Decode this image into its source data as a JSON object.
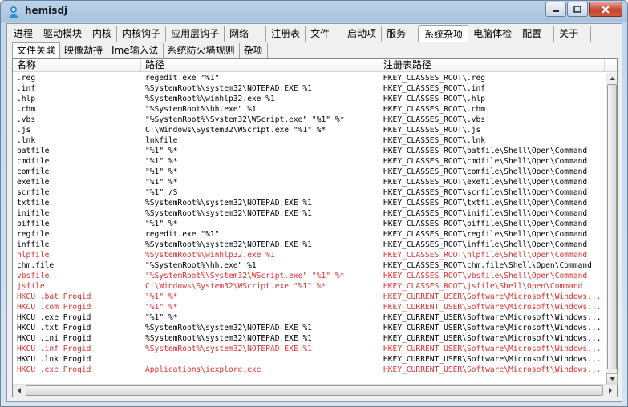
{
  "window": {
    "title": "hemisdj"
  },
  "caption": {
    "minimize": "▭",
    "maximize": "□",
    "close": "x"
  },
  "main_tabs": [
    {
      "label": "进程"
    },
    {
      "label": "驱动模块"
    },
    {
      "label": "内核"
    },
    {
      "label": "内核钩子"
    },
    {
      "label": "应用层钩子"
    },
    {
      "label": "网络"
    },
    {
      "label": "注册表"
    },
    {
      "label": "文件"
    },
    {
      "label": "启动项"
    },
    {
      "label": "服务"
    },
    {
      "label": "系统杂项",
      "active": true
    },
    {
      "label": "电脑体检"
    },
    {
      "label": "配置"
    },
    {
      "label": "关于"
    }
  ],
  "sub_tabs": [
    {
      "label": "文件关联",
      "active": true
    },
    {
      "label": "映像劫持"
    },
    {
      "label": "Ime输入法"
    },
    {
      "label": "系统防火墙规则"
    },
    {
      "label": "杂项"
    }
  ],
  "columns": {
    "name": "名称",
    "path": "路径",
    "reg": "注册表路径"
  },
  "rows": [
    {
      "name": ".reg",
      "path": "regedit.exe \"%1\"",
      "reg": "HKEY_CLASSES_ROOT\\.reg",
      "red": false
    },
    {
      "name": ".inf",
      "path": "%SystemRoot%\\system32\\NOTEPAD.EXE %1",
      "reg": "HKEY_CLASSES_ROOT\\.inf",
      "red": false
    },
    {
      "name": ".hlp",
      "path": "%SystemRoot%\\winhlp32.exe %1",
      "reg": "HKEY_CLASSES_ROOT\\.hlp",
      "red": false
    },
    {
      "name": ".chm",
      "path": "\"%SystemRoot%\\hh.exe\" %1",
      "reg": "HKEY_CLASSES_ROOT\\.chm",
      "red": false
    },
    {
      "name": ".vbs",
      "path": "\"%SystemRoot%\\System32\\WScript.exe\" \"%1\" %*",
      "reg": "HKEY_CLASSES_ROOT\\.vbs",
      "red": false
    },
    {
      "name": ".js",
      "path": "C:\\Windows\\System32\\WScript.exe \"%1\" %*",
      "reg": "HKEY_CLASSES_ROOT\\.js",
      "red": false
    },
    {
      "name": ".lnk",
      "path": "lnkfile",
      "reg": "HKEY_CLASSES_ROOT\\.lnk",
      "red": false
    },
    {
      "name": "batfile",
      "path": "\"%1\" %*",
      "reg": "HKEY_CLASSES_ROOT\\batfile\\Shell\\Open\\Command",
      "red": false
    },
    {
      "name": "cmdfile",
      "path": "\"%1\" %*",
      "reg": "HKEY_CLASSES_ROOT\\cmdfile\\Shell\\Open\\Command",
      "red": false
    },
    {
      "name": "comfile",
      "path": "\"%1\" %*",
      "reg": "HKEY_CLASSES_ROOT\\comfile\\Shell\\Open\\Command",
      "red": false
    },
    {
      "name": "exefile",
      "path": "\"%1\" %*",
      "reg": "HKEY_CLASSES_ROOT\\exefile\\Shell\\Open\\Command",
      "red": false
    },
    {
      "name": "scrfile",
      "path": "\"%1\" /S",
      "reg": "HKEY_CLASSES_ROOT\\scrfile\\Shell\\Open\\Command",
      "red": false
    },
    {
      "name": "txtfile",
      "path": "%SystemRoot%\\system32\\NOTEPAD.EXE %1",
      "reg": "HKEY_CLASSES_ROOT\\txtfile\\Shell\\Open\\Command",
      "red": false
    },
    {
      "name": "inifile",
      "path": "%SystemRoot%\\system32\\NOTEPAD.EXE %1",
      "reg": "HKEY_CLASSES_ROOT\\inifile\\Shell\\Open\\Command",
      "red": false
    },
    {
      "name": "piffile",
      "path": "\"%1\" %*",
      "reg": "HKEY_CLASSES_ROOT\\piffile\\Shell\\Open\\Command",
      "red": false
    },
    {
      "name": "regfile",
      "path": "regedit.exe \"%1\"",
      "reg": "HKEY_CLASSES_ROOT\\regfile\\Shell\\Open\\Command",
      "red": false
    },
    {
      "name": "inffile",
      "path": "%SystemRoot%\\system32\\NOTEPAD.EXE %1",
      "reg": "HKEY_CLASSES_ROOT\\inffile\\Shell\\Open\\Command",
      "red": false
    },
    {
      "name": "hlpfile",
      "path": "%SystemRoot%\\winhlp32.exe %1",
      "reg": "HKEY_CLASSES_ROOT\\hlpfile\\Shell\\Open\\Command",
      "red": true
    },
    {
      "name": "chm.file",
      "path": "\"%SystemRoot%\\hh.exe\" %1",
      "reg": "HKEY_CLASSES_ROOT\\chm.file\\Shell\\Open\\Command",
      "red": false
    },
    {
      "name": "vbsfile",
      "path": "\"%SystemRoot%\\System32\\WScript.exe\" \"%1\" %*",
      "reg": "HKEY_CLASSES_ROOT\\vbsfile\\Shell\\Open\\Command",
      "red": true
    },
    {
      "name": "jsfile",
      "path": "C:\\Windows\\System32\\WScript.exe \"%1\" %*",
      "reg": "HKEY_CLASSES_ROOT\\jsfile\\Shell\\Open\\Command",
      "red": true
    },
    {
      "name": "HKCU .bat Progid",
      "path": "\"%1\" %*",
      "reg": "HKEY_CURRENT_USER\\Software\\Microsoft\\Windows...",
      "red": true
    },
    {
      "name": "HKCU .com Progid",
      "path": "\"%1\" %*",
      "reg": "HKEY_CURRENT_USER\\Software\\Microsoft\\Windows...",
      "red": true
    },
    {
      "name": "HKCU .exe Progid",
      "path": "\"%1\" %*",
      "reg": "HKEY_CURRENT_USER\\Software\\Microsoft\\Windows...",
      "red": false
    },
    {
      "name": "HKCU .txt Progid",
      "path": "%SystemRoot%\\system32\\NOTEPAD.EXE %1",
      "reg": "HKEY_CURRENT_USER\\Software\\Microsoft\\Windows...",
      "red": false
    },
    {
      "name": "HKCU .ini Progid",
      "path": "%SystemRoot%\\system32\\NOTEPAD.EXE %1",
      "reg": "HKEY_CURRENT_USER\\Software\\Microsoft\\Windows...",
      "red": false
    },
    {
      "name": "HKCU .inf Progid",
      "path": "%SystemRoot%\\system32\\NOTEPAD.EXE %1",
      "reg": "HKEY_CURRENT_USER\\Software\\Microsoft\\Windows...",
      "red": true
    },
    {
      "name": "HKCU .lnk Progid",
      "path": "",
      "reg": "HKEY_CURRENT_USER\\Software\\Microsoft\\Windows...",
      "red": false
    },
    {
      "name": "HKCU .exe Progid",
      "path": "Applications\\iexplore.exe",
      "reg": "HKEY_CURRENT_USER\\Software\\Microsoft\\Windows...",
      "red": true
    }
  ],
  "colors": {
    "warning_text": "#e03030",
    "title_gradient_top": "#bcd3ea",
    "close_button": "#c7432d"
  }
}
